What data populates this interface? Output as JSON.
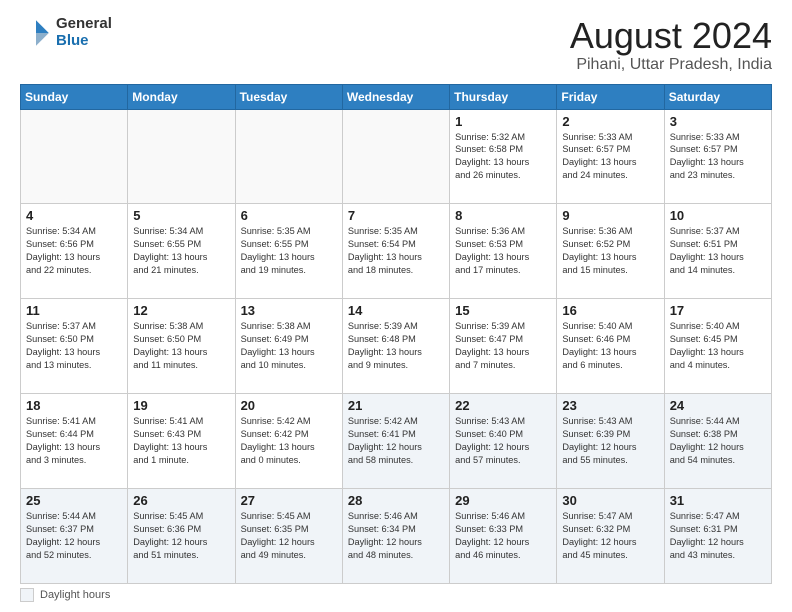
{
  "header": {
    "logo_general": "General",
    "logo_blue": "Blue",
    "main_title": "August 2024",
    "subtitle": "Pihani, Uttar Pradesh, India"
  },
  "footer": {
    "label": "Daylight hours"
  },
  "days_of_week": [
    "Sunday",
    "Monday",
    "Tuesday",
    "Wednesday",
    "Thursday",
    "Friday",
    "Saturday"
  ],
  "weeks": [
    [
      {
        "date": "",
        "info": ""
      },
      {
        "date": "",
        "info": ""
      },
      {
        "date": "",
        "info": ""
      },
      {
        "date": "",
        "info": ""
      },
      {
        "date": "1",
        "info": "Sunrise: 5:32 AM\nSunset: 6:58 PM\nDaylight: 13 hours\nand 26 minutes."
      },
      {
        "date": "2",
        "info": "Sunrise: 5:33 AM\nSunset: 6:57 PM\nDaylight: 13 hours\nand 24 minutes."
      },
      {
        "date": "3",
        "info": "Sunrise: 5:33 AM\nSunset: 6:57 PM\nDaylight: 13 hours\nand 23 minutes."
      }
    ],
    [
      {
        "date": "4",
        "info": "Sunrise: 5:34 AM\nSunset: 6:56 PM\nDaylight: 13 hours\nand 22 minutes."
      },
      {
        "date": "5",
        "info": "Sunrise: 5:34 AM\nSunset: 6:55 PM\nDaylight: 13 hours\nand 21 minutes."
      },
      {
        "date": "6",
        "info": "Sunrise: 5:35 AM\nSunset: 6:55 PM\nDaylight: 13 hours\nand 19 minutes."
      },
      {
        "date": "7",
        "info": "Sunrise: 5:35 AM\nSunset: 6:54 PM\nDaylight: 13 hours\nand 18 minutes."
      },
      {
        "date": "8",
        "info": "Sunrise: 5:36 AM\nSunset: 6:53 PM\nDaylight: 13 hours\nand 17 minutes."
      },
      {
        "date": "9",
        "info": "Sunrise: 5:36 AM\nSunset: 6:52 PM\nDaylight: 13 hours\nand 15 minutes."
      },
      {
        "date": "10",
        "info": "Sunrise: 5:37 AM\nSunset: 6:51 PM\nDaylight: 13 hours\nand 14 minutes."
      }
    ],
    [
      {
        "date": "11",
        "info": "Sunrise: 5:37 AM\nSunset: 6:50 PM\nDaylight: 13 hours\nand 13 minutes."
      },
      {
        "date": "12",
        "info": "Sunrise: 5:38 AM\nSunset: 6:50 PM\nDaylight: 13 hours\nand 11 minutes."
      },
      {
        "date": "13",
        "info": "Sunrise: 5:38 AM\nSunset: 6:49 PM\nDaylight: 13 hours\nand 10 minutes."
      },
      {
        "date": "14",
        "info": "Sunrise: 5:39 AM\nSunset: 6:48 PM\nDaylight: 13 hours\nand 9 minutes."
      },
      {
        "date": "15",
        "info": "Sunrise: 5:39 AM\nSunset: 6:47 PM\nDaylight: 13 hours\nand 7 minutes."
      },
      {
        "date": "16",
        "info": "Sunrise: 5:40 AM\nSunset: 6:46 PM\nDaylight: 13 hours\nand 6 minutes."
      },
      {
        "date": "17",
        "info": "Sunrise: 5:40 AM\nSunset: 6:45 PM\nDaylight: 13 hours\nand 4 minutes."
      }
    ],
    [
      {
        "date": "18",
        "info": "Sunrise: 5:41 AM\nSunset: 6:44 PM\nDaylight: 13 hours\nand 3 minutes."
      },
      {
        "date": "19",
        "info": "Sunrise: 5:41 AM\nSunset: 6:43 PM\nDaylight: 13 hours\nand 1 minute."
      },
      {
        "date": "20",
        "info": "Sunrise: 5:42 AM\nSunset: 6:42 PM\nDaylight: 13 hours\nand 0 minutes."
      },
      {
        "date": "21",
        "info": "Sunrise: 5:42 AM\nSunset: 6:41 PM\nDaylight: 12 hours\nand 58 minutes."
      },
      {
        "date": "22",
        "info": "Sunrise: 5:43 AM\nSunset: 6:40 PM\nDaylight: 12 hours\nand 57 minutes."
      },
      {
        "date": "23",
        "info": "Sunrise: 5:43 AM\nSunset: 6:39 PM\nDaylight: 12 hours\nand 55 minutes."
      },
      {
        "date": "24",
        "info": "Sunrise: 5:44 AM\nSunset: 6:38 PM\nDaylight: 12 hours\nand 54 minutes."
      }
    ],
    [
      {
        "date": "25",
        "info": "Sunrise: 5:44 AM\nSunset: 6:37 PM\nDaylight: 12 hours\nand 52 minutes."
      },
      {
        "date": "26",
        "info": "Sunrise: 5:45 AM\nSunset: 6:36 PM\nDaylight: 12 hours\nand 51 minutes."
      },
      {
        "date": "27",
        "info": "Sunrise: 5:45 AM\nSunset: 6:35 PM\nDaylight: 12 hours\nand 49 minutes."
      },
      {
        "date": "28",
        "info": "Sunrise: 5:46 AM\nSunset: 6:34 PM\nDaylight: 12 hours\nand 48 minutes."
      },
      {
        "date": "29",
        "info": "Sunrise: 5:46 AM\nSunset: 6:33 PM\nDaylight: 12 hours\nand 46 minutes."
      },
      {
        "date": "30",
        "info": "Sunrise: 5:47 AM\nSunset: 6:32 PM\nDaylight: 12 hours\nand 45 minutes."
      },
      {
        "date": "31",
        "info": "Sunrise: 5:47 AM\nSunset: 6:31 PM\nDaylight: 12 hours\nand 43 minutes."
      }
    ]
  ]
}
